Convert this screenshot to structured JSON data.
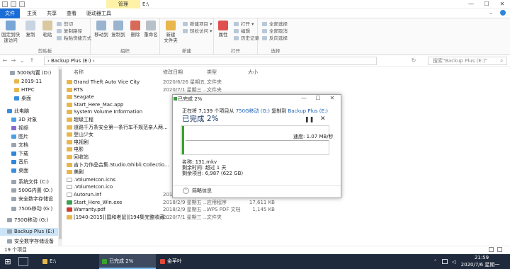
{
  "titlebar": {
    "context_tab": "管理",
    "title": "E:\\",
    "minimize": "—",
    "maximize": "☐",
    "close": "✕"
  },
  "ribbon_tabs": [
    "文件",
    "主页",
    "共享",
    "查看",
    "驱动器工具"
  ],
  "ribbon": {
    "clipboard": {
      "label": "剪贴板",
      "pin": "固定到快速访问",
      "copy": "复制",
      "paste": "粘贴",
      "cut": "剪切",
      "copy_path": "复制路径",
      "paste_shortcut": "粘贴快捷方式"
    },
    "organize": {
      "label": "组织",
      "move_to": "移动到",
      "copy_to": "复制到",
      "delete": "删除",
      "rename": "重命名"
    },
    "new": {
      "label": "新建",
      "new_folder": "新建\n文件夹",
      "new_item": "新建项目 ▾",
      "easy_access": "轻松访问 ▾"
    },
    "open": {
      "label": "打开",
      "properties": "属性",
      "open": "打开 ▾",
      "edit": "编辑",
      "history": "历史记录"
    },
    "select": {
      "label": "选择",
      "select_all": "全部选择",
      "select_none": "全部取消",
      "invert": "反向选择"
    }
  },
  "address": {
    "path": "›  Backup Plus (E:)  ›",
    "search_placeholder": "搜索\"Backup Plus (E:)\""
  },
  "nav": {
    "items": [
      {
        "label": "500G内置 (D:)",
        "color": "#9aa4ae"
      },
      {
        "label": "2019-11",
        "color": "#e8b64c"
      },
      {
        "label": "HTPC",
        "color": "#e8b64c"
      },
      {
        "label": "桌面",
        "color": "#3a8ddd"
      },
      {
        "label": "此电脑",
        "color": "#3a8ddd"
      },
      {
        "label": "3D 对象",
        "color": "#4aa0e0"
      },
      {
        "label": "视频",
        "color": "#8a6ad0"
      },
      {
        "label": "图片",
        "color": "#4aa0e0"
      },
      {
        "label": "文档",
        "color": "#9aa4ae"
      },
      {
        "label": "下载",
        "color": "#2f86d8"
      },
      {
        "label": "音乐",
        "color": "#2f86d8"
      },
      {
        "label": "桌面",
        "color": "#3a8ddd"
      },
      {
        "label": "系统文件 (C:)",
        "color": "#9aa4ae"
      },
      {
        "label": "500G内置 (D:)",
        "color": "#9aa4ae"
      },
      {
        "label": "安全数字存储设",
        "color": "#9aa4ae"
      },
      {
        "label": "750G移动 (G:)",
        "color": "#9aa4ae"
      },
      {
        "label": "750G移动 (G:)",
        "color": "#9aa4ae"
      },
      {
        "label": "Backup Plus (E:)",
        "color": "#9aa4ae"
      },
      {
        "label": "安全数字存储设备",
        "color": "#9aa4ae"
      }
    ]
  },
  "columns": {
    "name": "名称",
    "date": "修改日期",
    "type": "类型",
    "size": "大小"
  },
  "files": [
    {
      "name": "Grand Theft Auto Vice City",
      "date": "2020/6/26 星期五...",
      "type": "文件夹",
      "size": "",
      "color": "#e8b64c"
    },
    {
      "name": "RTS",
      "date": "2020/7/1 星期三 ...",
      "type": "文件夹",
      "size": "",
      "color": "#e8b64c"
    },
    {
      "name": "Seagate",
      "date": "",
      "type": "",
      "size": "",
      "color": "#e8b64c"
    },
    {
      "name": "Start_Here_Mac.app",
      "date": "",
      "type": "",
      "size": "",
      "color": "#e8b64c"
    },
    {
      "name": "System Volume Information",
      "date": "",
      "type": "",
      "size": "",
      "color": "#e8b64c"
    },
    {
      "name": "超级工程",
      "date": "",
      "type": "",
      "size": "",
      "color": "#e8b64c"
    },
    {
      "name": "道路千万条安全第一条行车不规范亲人两...",
      "date": "",
      "type": "",
      "size": "",
      "color": "#e8b64c"
    },
    {
      "name": "登山少女",
      "date": "",
      "type": "",
      "size": "",
      "color": "#e8b64c"
    },
    {
      "name": "电视剧",
      "date": "",
      "type": "",
      "size": "",
      "color": "#e8b64c"
    },
    {
      "name": "电影",
      "date": "",
      "type": "",
      "size": "",
      "color": "#e8b64c"
    },
    {
      "name": "回收站",
      "date": "",
      "type": "",
      "size": "",
      "color": "#e8b64c"
    },
    {
      "name": "吉卜力作品合集.Studio.Ghibli.Collectio...",
      "date": "",
      "type": "",
      "size": "",
      "color": "#e8b64c"
    },
    {
      "name": "美剧",
      "date": "",
      "type": "",
      "size": "",
      "color": "#e8b64c"
    },
    {
      "name": ".VolumeIcon.icns",
      "date": "",
      "type": "",
      "size": "",
      "color": "#ffffff"
    },
    {
      "name": ".VolumeIcon.ico",
      "date": "",
      "type": "",
      "size": "",
      "color": "#ffffff"
    },
    {
      "name": "Autorun.inf",
      "date": "2018/2/22 星期四...",
      "type": "安装信息",
      "size": "",
      "color": "#ffffff"
    },
    {
      "name": "Start_Here_Win.exe",
      "date": "2018/2/9 星期五 ...",
      "type": "应用程序",
      "size": "17,611 KB",
      "color": "#3aa050"
    },
    {
      "name": "Warranty.pdf",
      "date": "2018/2/9 星期五 ...",
      "type": "WPS PDF 文档",
      "size": "1,145 KB",
      "color": "#d03a2a"
    },
    {
      "name": "[1940-2015][国和老鼠][194集完整收藏...",
      "date": "2020/7/1 星期三 ...",
      "type": "文件夹",
      "size": "",
      "color": "#e8b64c"
    }
  ],
  "status": {
    "count": "19 个项目"
  },
  "dialog": {
    "title": "已完成 2%",
    "desc_prefix": "正在将 7,139 个项目从 ",
    "desc_src": "750G移动 (G:)",
    "desc_mid": " 复制到 ",
    "desc_dst": "Backup Plus (E:)",
    "percent": "已完成 2%",
    "progress": 0.02,
    "pause_icon": "❚❚",
    "cancel_icon": "✕",
    "speed": "速度: 1.07 MB/秒",
    "name_line": "名称: 131.mkv",
    "time_line": "剩余时间: 超过 1 天",
    "items_line": "剩余项目: 6,987 (622 GB)",
    "less_info": "简略信息"
  },
  "taskbar": {
    "start_icon": "⊞",
    "buttons": [
      {
        "label": "E:\\",
        "active": false
      },
      {
        "label": "已完成 2%",
        "active": true
      },
      {
        "label": "金苹叶",
        "active": false
      }
    ],
    "time": "21:59",
    "date": "2020/7/6 星期一"
  }
}
